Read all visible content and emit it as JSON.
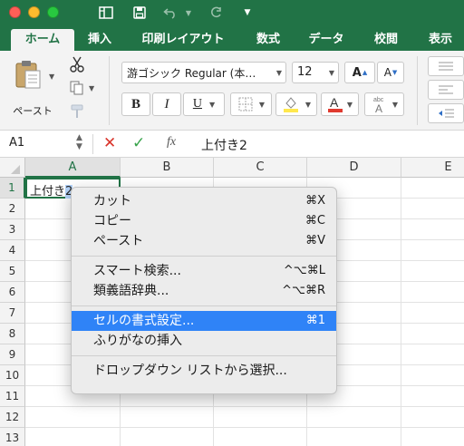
{
  "tabs": [
    "ホーム",
    "挿入",
    "印刷レイアウト",
    "数式",
    "データ",
    "校閲",
    "表示"
  ],
  "ribbon": {
    "paste_label": "ペースト",
    "font_name": "游ゴシック Regular (本…",
    "font_size": "12",
    "bold": "B",
    "italic": "I",
    "underline": "U",
    "font_color": "#e03a2f",
    "highlight_color": "#ffe84d"
  },
  "formula_bar": {
    "name_box": "A1",
    "fx": "fx",
    "content": "上付き2"
  },
  "columns": [
    "A",
    "B",
    "C",
    "D",
    "E"
  ],
  "rows": [
    "1",
    "2",
    "3",
    "4",
    "5",
    "6",
    "7",
    "8",
    "9",
    "10",
    "11",
    "12",
    "13"
  ],
  "cell_a1": {
    "text": "上付き",
    "selected_char": "2"
  },
  "context_menu": {
    "groups": [
      [
        {
          "label": "カット",
          "shortcut": "⌘X"
        },
        {
          "label": "コピー",
          "shortcut": "⌘C"
        },
        {
          "label": "ペースト",
          "shortcut": "⌘V"
        }
      ],
      [
        {
          "label": "スマート検索...",
          "shortcut": "^⌥⌘L"
        },
        {
          "label": "類義語辞典...",
          "shortcut": "^⌥⌘R"
        }
      ],
      [
        {
          "label": "セルの書式設定...",
          "shortcut": "⌘1",
          "highlighted": true
        },
        {
          "label": "ふりがなの挿入",
          "shortcut": ""
        }
      ],
      [
        {
          "label": "ドロップダウン リストから選択...",
          "shortcut": ""
        }
      ]
    ]
  },
  "colors": {
    "excel_green": "#217346",
    "menu_highlight": "#2f83f7"
  }
}
